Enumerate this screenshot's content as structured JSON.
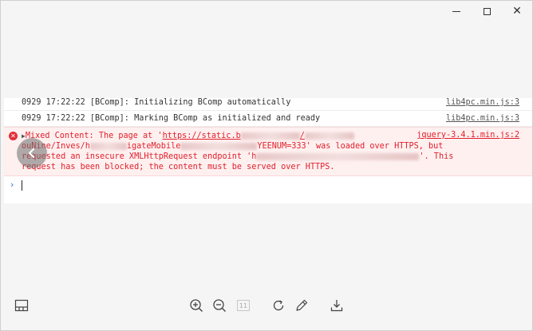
{
  "window": {
    "controls": {
      "minimize": "minimize",
      "maximize": "maximize",
      "close": "close"
    }
  },
  "console": {
    "rows": [
      {
        "message": "0929 17:22:22 [BComp]: Initializing BComp automatically",
        "source": "lib4pc.min.js:3"
      },
      {
        "message": "0929 17:22:22 [BComp]: Marking BComp as initialized and ready",
        "source": "lib4pc.min.js:3"
      }
    ],
    "error": {
      "toggle": "▶",
      "line1_prefix": "Mixed Content: The page at '",
      "line1_url": "https://static.b",
      "line1_suffix_after_blur": "/",
      "source": "jquery-3.4.1.min.js:2",
      "line2_prefix": "ouNine/Inves/h",
      "line2_mid": "igateMobile",
      "line2_tail": "YEENUM=333' was loaded over HTTPS, but",
      "line3_prefix": "requested an insecure XMLHttpRequest endpoint 'h",
      "line3_tail": "'. This",
      "line4": "request has been blocked; the content must be served over HTTPS."
    },
    "prompt": {
      "chevron": "›"
    }
  },
  "toolbar": {
    "icons": [
      "panel-toggle-icon",
      "zoom-in-icon",
      "zoom-out-icon",
      "page-number",
      "refresh-icon",
      "edit-icon",
      "download-icon"
    ],
    "page_number": "11"
  },
  "colors": {
    "error_text": "#e0202a",
    "error_bg": "#fff0f0",
    "prompt_chevron": "#2b6fd6"
  }
}
